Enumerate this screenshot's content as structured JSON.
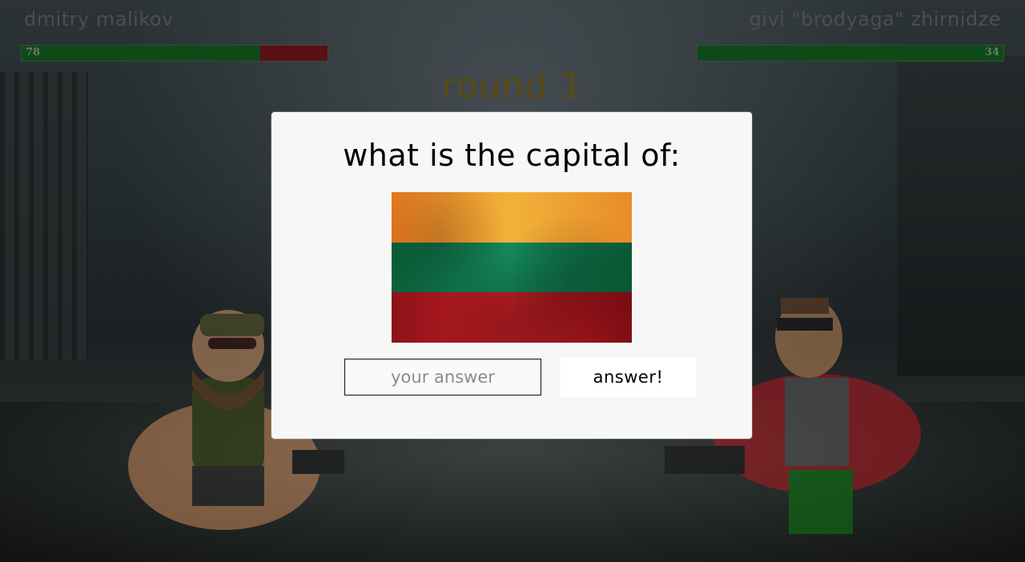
{
  "players": {
    "left": {
      "name": "dmitry malikov",
      "hp": 78,
      "hp_fraction": 0.78
    },
    "right": {
      "name": "givi \"brodyaga\" zhirnidze",
      "hp": 34,
      "hp_fraction": 1.0
    }
  },
  "round": {
    "title": "round 1"
  },
  "modal": {
    "question": "what is the capital of:",
    "flag_icon": "lithuania-flag-icon",
    "answer_placeholder": "your answer",
    "answer_value": "",
    "submit_label": "answer!"
  },
  "colors": {
    "hp_fill": "#0e4a18",
    "hp_loss": "#5a0f14",
    "round_title": "#5b4a16",
    "modal_bg": "#f7f7f7"
  }
}
